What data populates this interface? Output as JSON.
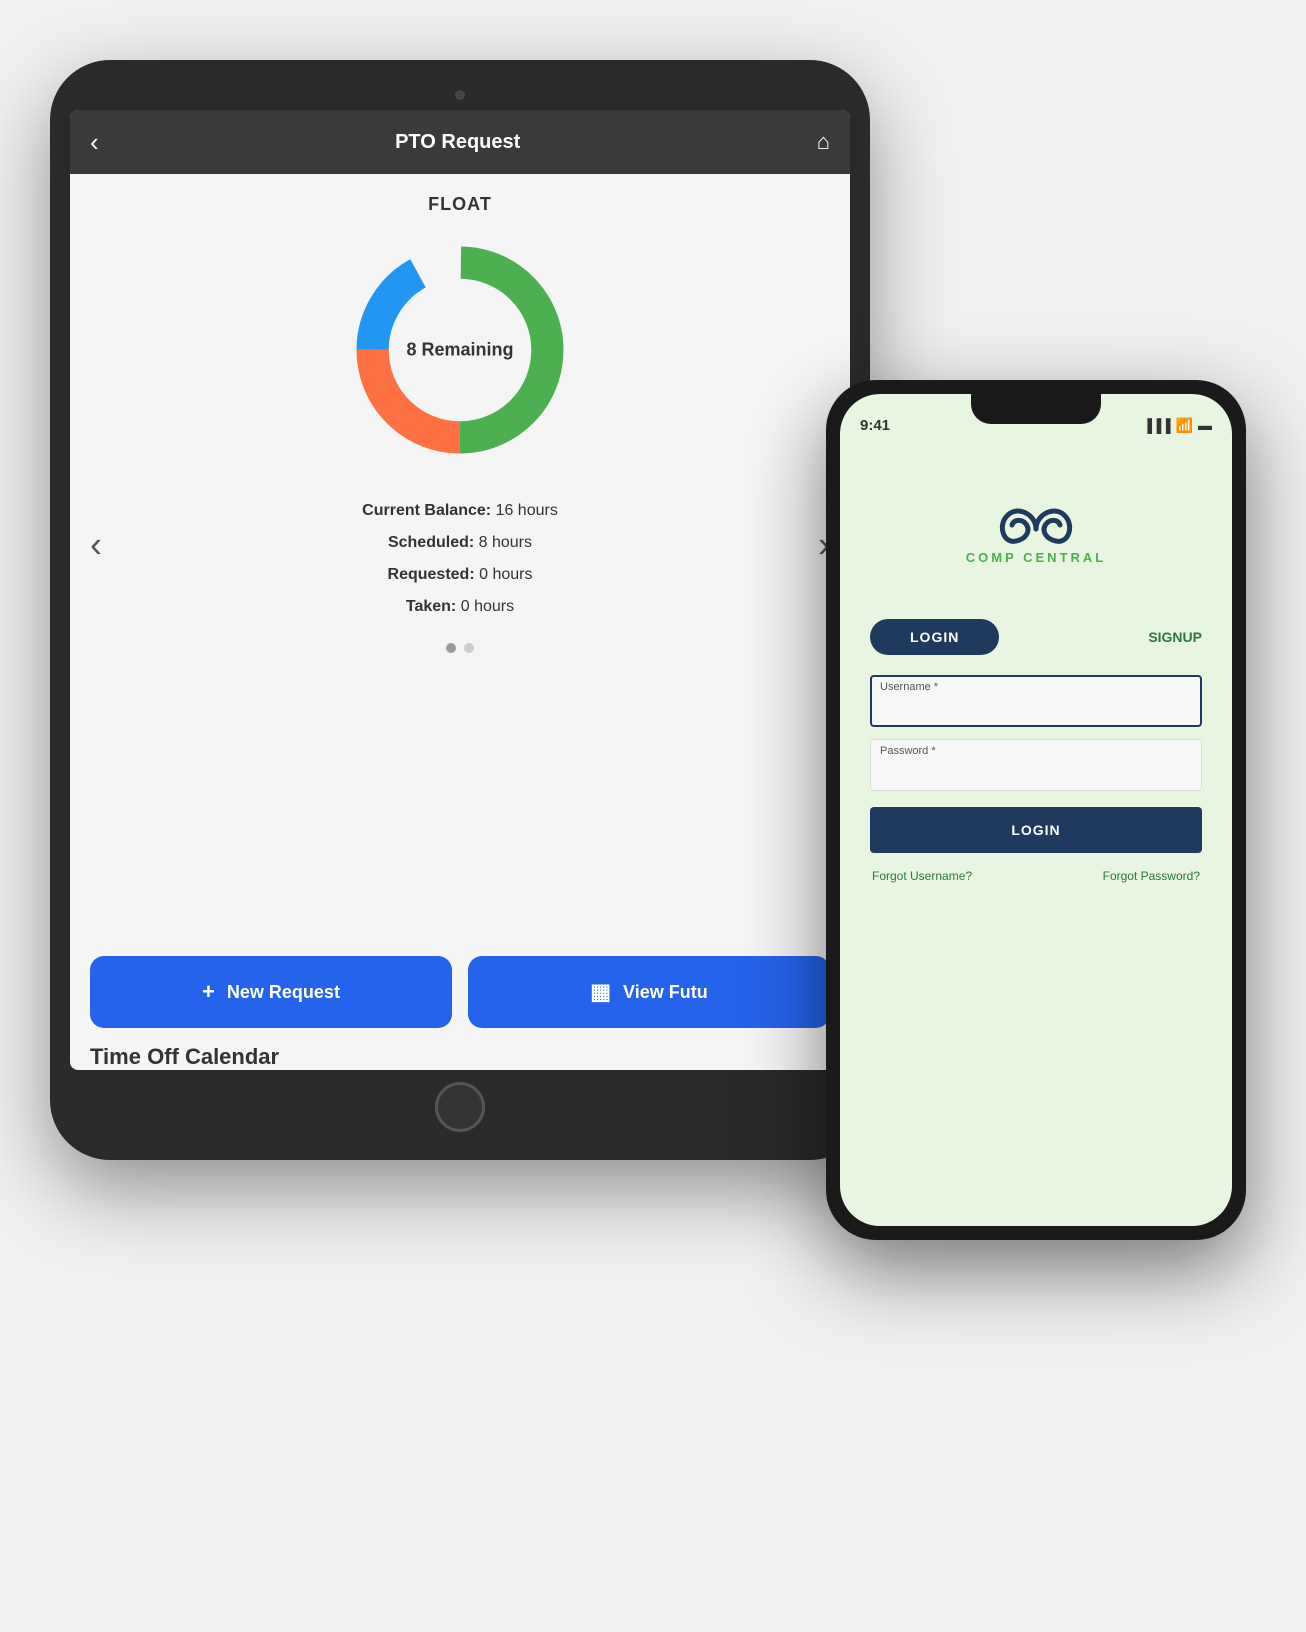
{
  "tablet": {
    "header": {
      "title": "PTO Request",
      "back_icon": "‹",
      "home_icon": "⌂"
    },
    "float_label": "FLOAT",
    "donut": {
      "remaining_text": "8 Remaining",
      "segments": [
        {
          "label": "scheduled",
          "color": "#4caf50",
          "percent": 50
        },
        {
          "label": "requested",
          "color": "#ff7043",
          "percent": 25
        },
        {
          "label": "taken",
          "color": "#2196f3",
          "percent": 17
        },
        {
          "label": "remaining",
          "color": "#e0e0e0",
          "percent": 8
        }
      ]
    },
    "balance": {
      "current_balance_label": "Current Balance:",
      "current_balance_value": "16 hours",
      "scheduled_label": "Scheduled:",
      "scheduled_value": "8 hours",
      "requested_label": "Requested:",
      "requested_value": "0 hours",
      "taken_label": "Taken:",
      "taken_value": "0 hours"
    },
    "nav_left": "‹",
    "nav_right": "›",
    "buttons": {
      "new_request": "New Request",
      "view_future": "View Futu",
      "new_request_icon": "+",
      "view_future_icon": "▦"
    },
    "time_off_calendar": "Time Off Calendar"
  },
  "phone": {
    "status_bar": {
      "time": "9:41",
      "signal": "▐▐▐",
      "wifi": "WiFi",
      "battery": "Battery"
    },
    "logo": {
      "brand": "COMP CENTRAL"
    },
    "tabs": {
      "login": "LOGIN",
      "signup": "SIGNUP"
    },
    "form": {
      "username_label": "Username *",
      "username_placeholder": "",
      "password_label": "Password *",
      "password_placeholder": "",
      "login_button": "LOGIN",
      "forgot_username": "Forgot Username?",
      "forgot_password": "Forgot Password?"
    }
  },
  "colors": {
    "donut_green": "#4caf50",
    "donut_orange": "#ff7043",
    "donut_blue": "#2196f3",
    "donut_light": "#e0e0e0",
    "btn_blue": "#2563eb",
    "nav_dark": "#1e3a5f",
    "link_green": "#2a7a3b"
  }
}
